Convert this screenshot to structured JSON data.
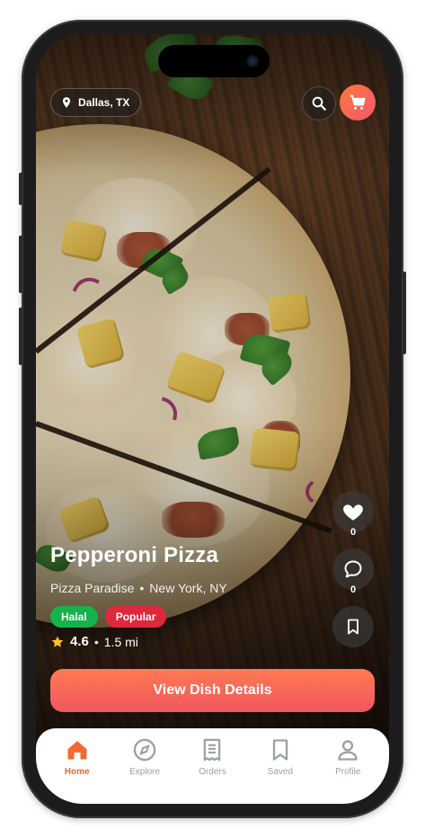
{
  "location": {
    "label": "Dallas, TX"
  },
  "header": {
    "search_icon": "search-icon",
    "cart_icon": "cart-icon"
  },
  "actions": {
    "likes": {
      "icon": "heart-icon",
      "count": "0"
    },
    "comments": {
      "icon": "comment-icon",
      "count": "0"
    },
    "save": {
      "icon": "bookmark-icon"
    }
  },
  "dish": {
    "name": "Pepperoni Pizza",
    "restaurant": "Pizza Paradise",
    "separator": "•",
    "city": "New York, NY",
    "tags": [
      {
        "label": "Halal",
        "color": "#16b24b"
      },
      {
        "label": "Popular",
        "color": "#e0283c"
      }
    ],
    "rating": "4.6",
    "distance": "1.5 mi"
  },
  "cta": {
    "label": "View Dish Details"
  },
  "tabs": [
    {
      "label": "Home",
      "icon": "home-icon",
      "active": true
    },
    {
      "label": "Explore",
      "icon": "compass-icon",
      "active": false
    },
    {
      "label": "Orders",
      "icon": "receipt-icon",
      "active": false
    },
    {
      "label": "Saved",
      "icon": "bookmark-icon",
      "active": false
    },
    {
      "label": "Profile",
      "icon": "user-icon",
      "active": false
    }
  ],
  "colors": {
    "accent": "#f26a33",
    "cta_start": "#ff7a52",
    "cta_end": "#f0565e",
    "tab_inactive": "#9aa0a6"
  }
}
